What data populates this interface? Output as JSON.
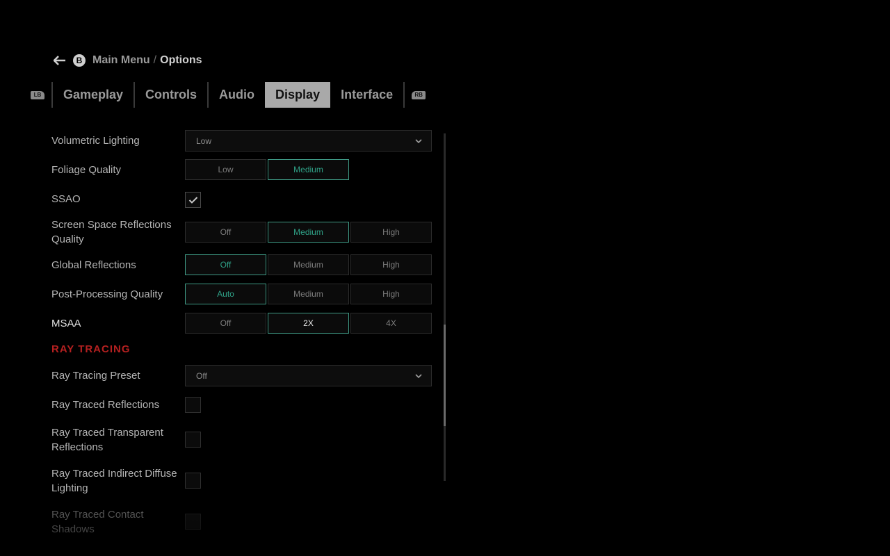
{
  "breadcrumb": {
    "b_button": "B",
    "parent": "Main Menu",
    "separator": "/",
    "current": "Options"
  },
  "tabs": {
    "lb": "LB",
    "rb": "RB",
    "items": [
      {
        "label": "Gameplay"
      },
      {
        "label": "Controls"
      },
      {
        "label": "Audio"
      },
      {
        "label": "Display",
        "active": true
      },
      {
        "label": "Interface"
      }
    ]
  },
  "settings": {
    "volumetric_lighting": {
      "label": "Volumetric Lighting",
      "value": "Low"
    },
    "foliage_quality": {
      "label": "Foliage Quality",
      "options": [
        "Low",
        "Medium"
      ],
      "selected": "Medium"
    },
    "ssao": {
      "label": "SSAO",
      "checked": true
    },
    "ssr_quality": {
      "label": "Screen Space Reflections Quality",
      "options": [
        "Off",
        "Medium",
        "High"
      ],
      "selected": "Medium"
    },
    "global_reflections": {
      "label": "Global Reflections",
      "options": [
        "Off",
        "Medium",
        "High"
      ],
      "selected": "Off"
    },
    "post_processing": {
      "label": "Post-Processing Quality",
      "options": [
        "Auto",
        "Medium",
        "High"
      ],
      "selected": "Auto"
    },
    "msaa": {
      "label": "MSAA",
      "options": [
        "Off",
        "2X",
        "4X"
      ],
      "selected": "2X"
    },
    "ray_tracing_section": "RAY TRACING",
    "ray_tracing_preset": {
      "label": "Ray Tracing Preset",
      "value": "Off"
    },
    "rt_reflections": {
      "label": "Ray Traced Reflections",
      "checked": false
    },
    "rt_transparent": {
      "label": "Ray Traced Transparent Reflections",
      "checked": false
    },
    "rt_indirect": {
      "label": "Ray Traced Indirect Diffuse Lighting",
      "checked": false
    },
    "rt_contact_shadows": {
      "label": "Ray Traced Contact Shadows",
      "checked": false
    }
  },
  "colors": {
    "accent": "#3f9a85",
    "section": "#b52020",
    "background": "#000000"
  }
}
